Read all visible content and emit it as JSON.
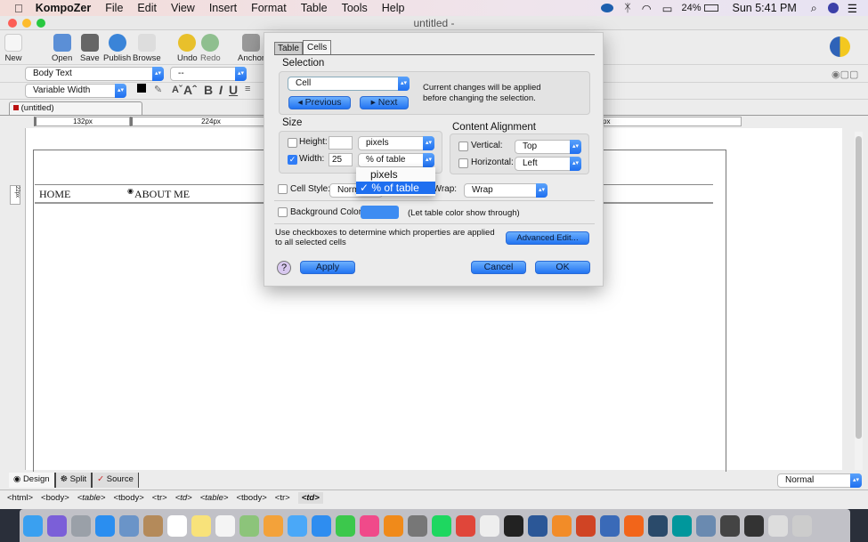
{
  "menubar": {
    "app": "KompoZer",
    "items": [
      "File",
      "Edit",
      "View",
      "Insert",
      "Format",
      "Table",
      "Tools",
      "Help"
    ],
    "battery": "24%",
    "clock": "Sun 5:41 PM"
  },
  "window": {
    "title": "untitled -"
  },
  "toolbar": {
    "buttons": [
      {
        "label": "New",
        "icon": "new-page-icon",
        "color": "#f4f4f4"
      },
      {
        "label": "Open",
        "icon": "open-folder-icon",
        "color": "#5b8fd6"
      },
      {
        "label": "Save",
        "icon": "floppy-disk-icon",
        "color": "#555555"
      },
      {
        "label": "Publish",
        "icon": "globe-icon",
        "color": "#3a84d8"
      },
      {
        "label": "Browse",
        "icon": "magnifier-icon",
        "color": "#dddddd"
      },
      {
        "label": "Undo",
        "icon": "undo-arrow-icon",
        "color": "#e8c02b"
      },
      {
        "label": "Redo",
        "icon": "redo-arrow-icon",
        "color": "#8fbf8f"
      },
      {
        "label": "Anchor",
        "icon": "anchor-icon",
        "color": "#888888"
      }
    ]
  },
  "format": {
    "paragraph": "Body Text",
    "font": "--",
    "width": "Variable Width",
    "bold": "B",
    "italic": "I",
    "underline": "U"
  },
  "doc_tab": "(untitled)",
  "ruler": {
    "col1": "132px",
    "col2": "224px",
    "col3": "px",
    "row": "22px"
  },
  "page": {
    "cells": [
      "HOME",
      "ABOUT ME"
    ]
  },
  "dialog": {
    "tabs": [
      "Table",
      "Cells"
    ],
    "active_tab": "Cells",
    "selection": {
      "title": "Selection",
      "value": "Cell",
      "prev": "Previous",
      "next": "Next",
      "note": "Current changes will be applied before changing the selection."
    },
    "size": {
      "title": "Size",
      "height_label": "Height:",
      "height_value": "",
      "height_unit": "pixels",
      "height_checked": false,
      "width_label": "Width:",
      "width_value": "25",
      "width_unit": "% of table",
      "width_checked": true
    },
    "dropdown": {
      "options": [
        "pixels",
        "% of table"
      ],
      "selected": "% of table"
    },
    "alignment": {
      "title": "Content Alignment",
      "vertical_label": "Vertical:",
      "vertical": "Top",
      "horizontal_label": "Horizontal:",
      "horizontal": "Left"
    },
    "cell_style_label": "Cell Style:",
    "cell_style": "Norm",
    "text_wrap_label": "t Wrap:",
    "text_wrap": "Wrap",
    "bg_label": "Background Color:",
    "bg_color": "#3d8cf2",
    "bg_note": "(Let table color show through)",
    "hint": "Use checkboxes to determine which properties are applied to all selected cells",
    "advanced": "Advanced Edit...",
    "help": "?",
    "apply": "Apply",
    "cancel": "Cancel",
    "ok": "OK"
  },
  "view_tabs": [
    "Design",
    "Split",
    "Source"
  ],
  "status_tags": [
    "<html>",
    "<body>",
    "<table>",
    "<tbody>",
    "<tr>",
    "<td>",
    "<table>",
    "<tbody>",
    "<tr>",
    "<td>"
  ],
  "mode": "Normal",
  "dock": [
    {
      "name": "finder-icon",
      "color": "#3aa0f0"
    },
    {
      "name": "siri-icon",
      "color": "#7b5fd8"
    },
    {
      "name": "launchpad-icon",
      "color": "#9aa0a8"
    },
    {
      "name": "safari-icon",
      "color": "#2a8ef0"
    },
    {
      "name": "preview-icon",
      "color": "#6a94c8"
    },
    {
      "name": "contacts-icon",
      "color": "#b48a5a"
    },
    {
      "name": "calendar-icon",
      "color": "#ffffff"
    },
    {
      "name": "notes-icon",
      "color": "#f8e27a"
    },
    {
      "name": "reminders-icon",
      "color": "#f4f4f4"
    },
    {
      "name": "maps-icon",
      "color": "#8cc47a"
    },
    {
      "name": "photos-icon",
      "color": "#f3a23a"
    },
    {
      "name": "messages-icon",
      "color": "#4aa8f8"
    },
    {
      "name": "app-store-icon",
      "color": "#2e8df0"
    },
    {
      "name": "facetime-icon",
      "color": "#3cc84c"
    },
    {
      "name": "itunes-icon",
      "color": "#f04a8a"
    },
    {
      "name": "ibooks-icon",
      "color": "#f08a1a"
    },
    {
      "name": "system-preferences-icon",
      "color": "#777777"
    },
    {
      "name": "spotify-icon",
      "color": "#1ed760"
    },
    {
      "name": "chrome-icon",
      "color": "#e0463a"
    },
    {
      "name": "textedit-icon",
      "color": "#eeeeee"
    },
    {
      "name": "inkscape-icon",
      "color": "#222222"
    },
    {
      "name": "word-icon",
      "color": "#2b5797"
    },
    {
      "name": "fusion-icon",
      "color": "#f28c28"
    },
    {
      "name": "powerpoint-icon",
      "color": "#d04424"
    },
    {
      "name": "kompozer-icon",
      "color": "#3a6ab8"
    },
    {
      "name": "firefox-icon",
      "color": "#f2651a"
    },
    {
      "name": "quicktime-icon",
      "color": "#2a4a6a"
    },
    {
      "name": "arduino-icon",
      "color": "#00979c"
    },
    {
      "name": "image-capture-icon",
      "color": "#6a8ab0"
    },
    {
      "name": "document-icon",
      "color": "#444444"
    },
    {
      "name": "terminal-window-icon",
      "color": "#333333"
    },
    {
      "name": "screenshot-icon",
      "color": "#dddddd"
    },
    {
      "name": "trash-icon",
      "color": "#cccccc"
    }
  ]
}
